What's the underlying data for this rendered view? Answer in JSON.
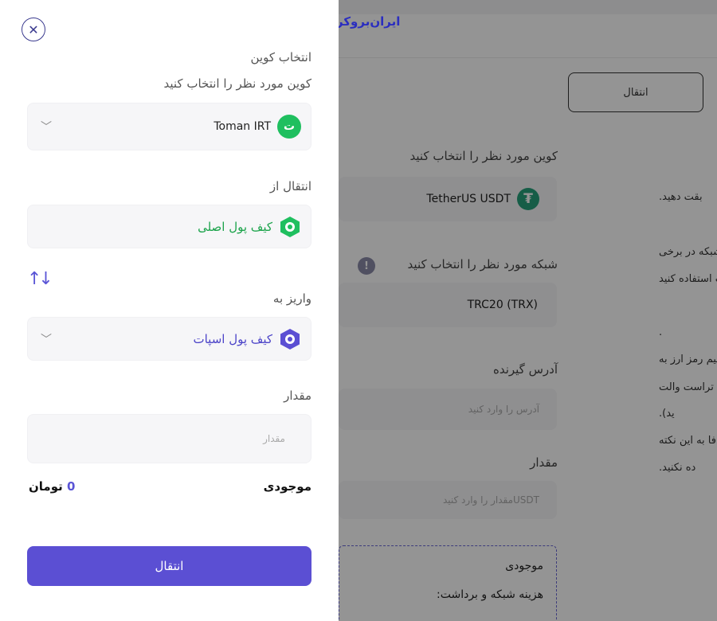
{
  "logo": {
    "text": "ایران‌بروکر"
  },
  "background": {
    "transfer_button": "انتقال",
    "coin_label": "کوین مورد نظر را انتخاب کنید",
    "coin_value": "TetherUS USDT",
    "coin_icon": "tether-icon",
    "network_label": "شبکه مورد نظر را انتخاب کنید",
    "network_value": "TRC20 (TRX)",
    "address_label": "آدرس گیرنده",
    "address_placeholder": "آدرس را وارد کنید",
    "amount_label": "مقدار",
    "amount_unit": "USDT",
    "amount_placeholder": "مقدار را وارد کنید",
    "balance_label": "موجودی",
    "fee_label": "هزینه شبکه و برداشت:",
    "notes": [
      "بقت دهید.",
      "شبکه در برخی",
      "ت استفاده کنید",
      ".",
      "تقیم رمز ارز به",
      "ند تراست والت",
      "ید).",
      "فا به این نکته",
      "ده نکنید."
    ]
  },
  "panel": {
    "title": "انتخاب کوین",
    "coin_label": "کوین مورد نظر را انتخاب کنید",
    "coin_value": "Toman IRT",
    "coin_icon_glyph": "ت",
    "from_label": "انتقال از",
    "from_value": "کیف پول اصلی",
    "to_label": "واریز به",
    "to_value": "کیف پول اسپات",
    "amount_label": "مقدار",
    "amount_placeholder": "مقدار",
    "balance_label": "موجودی",
    "balance_number": "0",
    "balance_unit": "تومان",
    "submit_label": "انتقال"
  },
  "colors": {
    "primary": "#5b4fd3",
    "green": "#1fbf5f",
    "tether": "#26a17b",
    "overlay": "rgba(0,0,0,0.42)"
  }
}
